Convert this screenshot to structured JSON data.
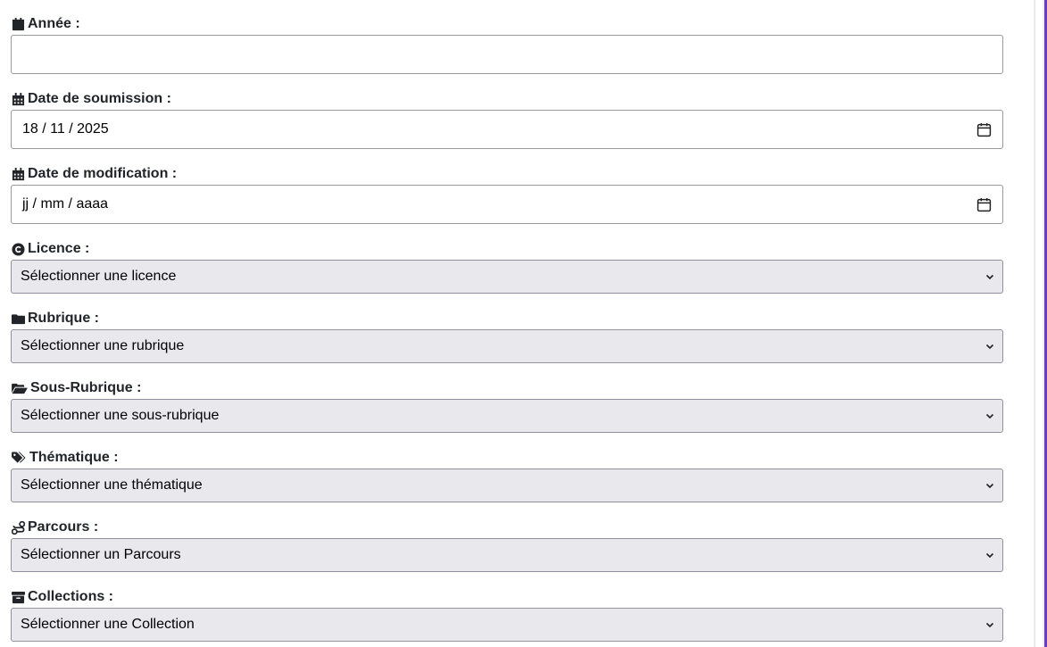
{
  "fields": {
    "annee": {
      "label": "Année :",
      "value": ""
    },
    "date_soumission": {
      "label": "Date de soumission :",
      "day": "18",
      "month": "11",
      "year": "2025"
    },
    "date_modification": {
      "label": "Date de modification :",
      "day": "jj",
      "month": "mm",
      "year": "aaaa"
    },
    "licence": {
      "label": "Licence :",
      "selected": "Sélectionner une licence"
    },
    "rubrique": {
      "label": "Rubrique :",
      "selected": "Sélectionner une rubrique"
    },
    "sous_rubrique": {
      "label": "Sous-Rubrique :",
      "selected": "Sélectionner une sous-rubrique"
    },
    "thematique": {
      "label": "Thématique :",
      "selected": "Sélectionner une thématique"
    },
    "parcours": {
      "label": "Parcours :",
      "selected": "Sélectionner un Parcours"
    },
    "collections": {
      "label": "Collections :",
      "selected": "Sélectionner une Collection"
    }
  },
  "icons": {
    "annee": "calendar-icon",
    "date_soumission": "calendar-days-icon",
    "date_modification": "calendar-days-icon",
    "licence": "copyright-icon",
    "rubrique": "folder-icon",
    "sous_rubrique": "folder-open-icon",
    "thematique": "tags-icon",
    "parcours": "route-icon",
    "collections": "archive-icon"
  },
  "colors": {
    "select_bg": "#e9e8ed",
    "accent_edge": "#6a3fbf"
  }
}
